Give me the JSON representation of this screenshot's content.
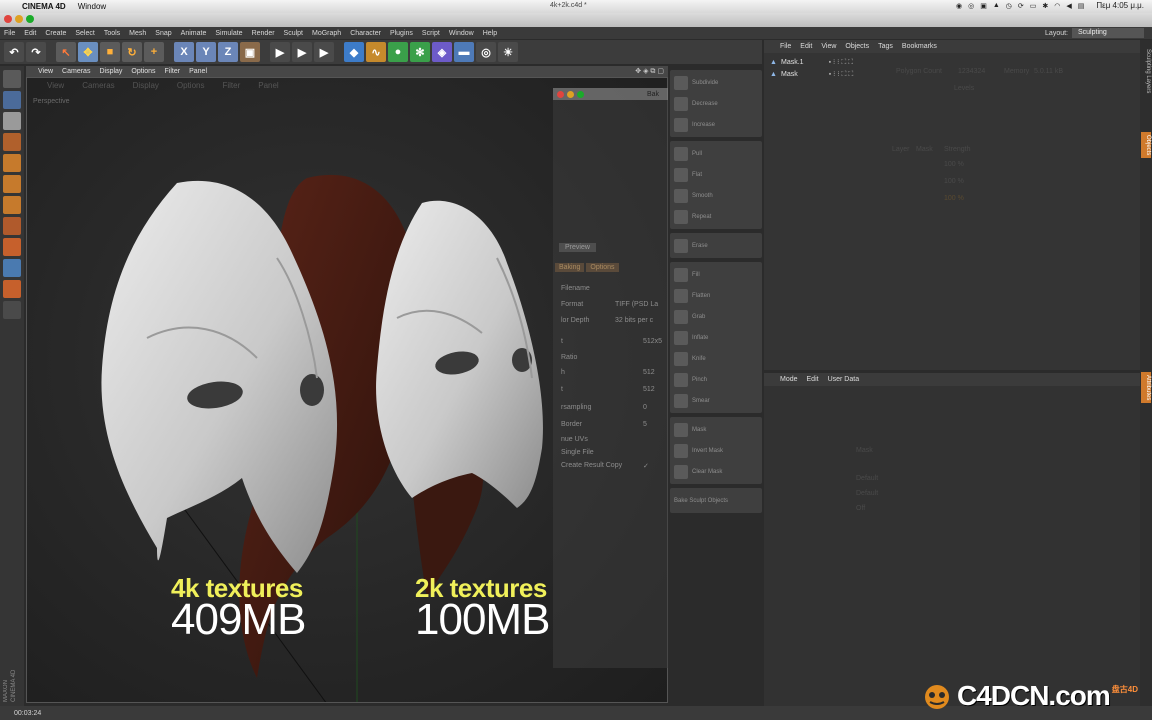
{
  "mac_menubar": {
    "app_name": "CINEMA 4D",
    "window_menu": "Window",
    "document_title": "4k+2k.c4d *",
    "clock": "Πεμ 4:05 μ.μ."
  },
  "c4d_menu": {
    "items": [
      "File",
      "Edit",
      "Create",
      "Select",
      "Tools",
      "Mesh",
      "Snap",
      "Animate",
      "Simulate",
      "Render",
      "Sculpt",
      "MoGraph",
      "Character",
      "Plugins",
      "Script",
      "Window",
      "Help"
    ],
    "layout_label": "Layout:",
    "layout_value": "Sculpting"
  },
  "viewport": {
    "menu": [
      "View",
      "Cameras",
      "Display",
      "Options",
      "Filter",
      "Panel"
    ],
    "ghost_menu": [
      "View",
      "Cameras",
      "Display",
      "Options",
      "Filter",
      "Panel"
    ],
    "camera": "Perspective",
    "label_left_title": "4k textures",
    "label_left_size": "409MB",
    "label_right_title": "2k textures",
    "label_right_size": "100MB"
  },
  "bake_dialog": {
    "title": "Bak",
    "tabs": [
      "Preview"
    ],
    "tabs2": [
      "Baking",
      "Options"
    ],
    "rows": [
      {
        "label": "Filename",
        "value": ""
      },
      {
        "label": "Format",
        "value": "TIFF (PSD La"
      },
      {
        "label": "lor Depth",
        "value": "32 bits per c"
      },
      {
        "label": "t",
        "value": "512x5"
      },
      {
        "label": "Ratio",
        "value": ""
      },
      {
        "label": "h",
        "value": "512"
      },
      {
        "label": "t",
        "value": "512"
      },
      {
        "label": "rsampling",
        "value": "0"
      },
      {
        "label": "Border",
        "value": "5"
      },
      {
        "label": "nue UVs",
        "value": ""
      },
      {
        "label": "Single File",
        "value": ""
      },
      {
        "label": "Create Result Copy",
        "value": "✓"
      }
    ]
  },
  "sculpt_tools": {
    "groups": [
      [
        "Subdivide",
        "Decrease",
        "Increase"
      ],
      [
        "Pull",
        "Flat",
        "Smooth",
        "Repeat"
      ],
      [
        "Erase"
      ],
      [
        "Fill",
        "Flatten",
        "Grab",
        "Inflate",
        "Knife",
        "Pinch",
        "Smear"
      ],
      [
        "Mask",
        "Invert Mask",
        "Clear Mask"
      ],
      [
        "Bake Sculpt Objects"
      ]
    ]
  },
  "object_manager": {
    "menu": [
      "File",
      "Edit",
      "View",
      "Objects",
      "Tags",
      "Bookmarks"
    ],
    "objects": [
      "Mask.1",
      "Mask"
    ],
    "ghost_texts": [
      "Polygon Count",
      "1234324",
      "Memory",
      "5.0.11 kB",
      "Levels",
      "Layer",
      "Mask",
      "Strength",
      "100 %",
      "100 %",
      "100 %"
    ]
  },
  "attribute_manager": {
    "menu": [
      "Mode",
      "Edit",
      "User Data"
    ],
    "ghost_texts": [
      "Mask",
      "Default",
      "Default",
      "Off"
    ]
  },
  "right_tabs": [
    "Sculpting Layers",
    "Objects",
    "Attributes"
  ],
  "status": {
    "time": "00:03:24",
    "maxon": "MAXON CINEMA 4D"
  },
  "watermark": {
    "text": "C4DCN.com",
    "sub": "盘古4D"
  },
  "colors": {
    "label_yellow": "#f0f05a",
    "accent_orange": "#d07a2c",
    "viewport_bg": "#262626"
  }
}
